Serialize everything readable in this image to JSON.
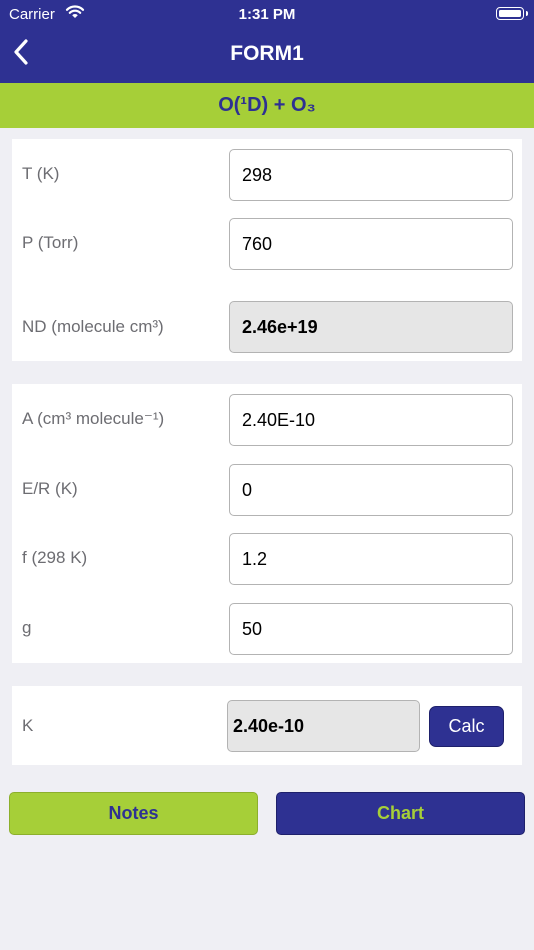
{
  "status_bar": {
    "carrier": "Carrier",
    "time": "1:31 PM"
  },
  "nav": {
    "title": "FORM1"
  },
  "reaction": {
    "label": "O(¹D) + O₃"
  },
  "conditions": {
    "rows": [
      {
        "label": "T (K)",
        "value": "298"
      },
      {
        "label": "P (Torr)",
        "value": "760"
      },
      {
        "label": "ND (molecule cm³)",
        "value": "2.46e+19"
      }
    ]
  },
  "parameters": {
    "rows": [
      {
        "label": "A (cm³ molecule⁻¹)",
        "value": "2.40E-10"
      },
      {
        "label": "E/R (K)",
        "value": "0"
      },
      {
        "label": "f (298 K)",
        "value": "1.2"
      },
      {
        "label": "g",
        "value": "50"
      }
    ]
  },
  "result": {
    "label": "K",
    "value": "2.40e-10",
    "calc_label": "Calc"
  },
  "buttons": {
    "notes": "Notes",
    "chart": "Chart"
  },
  "colors": {
    "nav_bg": "#2e3192",
    "accent_green": "#a6cf38"
  }
}
